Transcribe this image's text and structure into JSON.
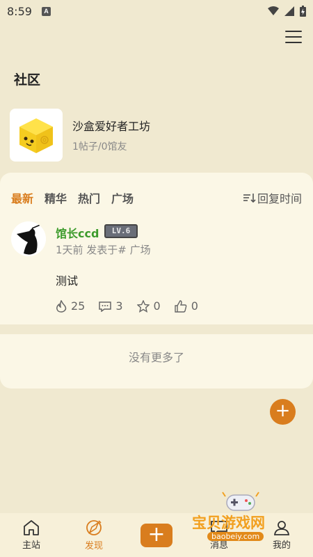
{
  "status_bar": {
    "time": "8:59",
    "notif_letter": "A"
  },
  "page": {
    "title": "社区"
  },
  "group": {
    "name": "沙盒爱好者工坊",
    "stats": "1帖子/0馆友"
  },
  "tabs": [
    {
      "label": "最新",
      "active": true
    },
    {
      "label": "精华",
      "active": false
    },
    {
      "label": "热门",
      "active": false
    },
    {
      "label": "广场",
      "active": false
    }
  ],
  "sort": {
    "label": "回复时间"
  },
  "post": {
    "username": "馆长ccd",
    "level": "LV.6",
    "meta": "1天前 发表于# 广场",
    "body": "测试",
    "views": "25",
    "comments": "3",
    "favorites": "0",
    "likes": "0"
  },
  "feed_footer": "没有更多了",
  "fab_label": "+",
  "nav": {
    "home": "主站",
    "discover": "发现",
    "post": "+",
    "messages": "消息",
    "mine": "我的"
  },
  "watermark": {
    "text": "宝贝游戏网",
    "url": "baobeiy.com"
  },
  "colors": {
    "accent": "#d97d1e",
    "username_green": "#3c9b2b",
    "background": "#f0e9d0",
    "panel": "#fbf7e6"
  }
}
